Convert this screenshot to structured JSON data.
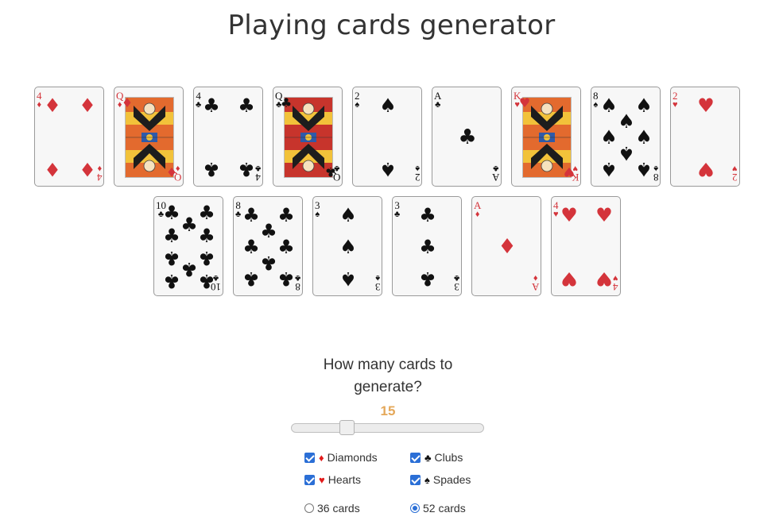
{
  "title": "Playing cards generator",
  "cards": [
    {
      "rank": "4",
      "suit": "diamonds",
      "symbol": "♦",
      "color": "red"
    },
    {
      "rank": "Q",
      "suit": "diamonds",
      "symbol": "♦",
      "color": "red",
      "face": true
    },
    {
      "rank": "4",
      "suit": "clubs",
      "symbol": "♣",
      "color": "black"
    },
    {
      "rank": "Q",
      "suit": "clubs",
      "symbol": "♣",
      "color": "black",
      "face": true
    },
    {
      "rank": "2",
      "suit": "spades",
      "symbol": "♠",
      "color": "black"
    },
    {
      "rank": "A",
      "suit": "clubs",
      "symbol": "♣",
      "color": "black"
    },
    {
      "rank": "K",
      "suit": "hearts",
      "symbol": "♥",
      "color": "red",
      "face": true
    },
    {
      "rank": "8",
      "suit": "spades",
      "symbol": "♠",
      "color": "black"
    },
    {
      "rank": "2",
      "suit": "hearts",
      "symbol": "♥",
      "color": "red"
    },
    {
      "rank": "10",
      "suit": "clubs",
      "symbol": "♣",
      "color": "black"
    },
    {
      "rank": "8",
      "suit": "clubs",
      "symbol": "♣",
      "color": "black"
    },
    {
      "rank": "3",
      "suit": "spades",
      "symbol": "♠",
      "color": "black"
    },
    {
      "rank": "3",
      "suit": "clubs",
      "symbol": "♣",
      "color": "black"
    },
    {
      "rank": "A",
      "suit": "diamonds",
      "symbol": "♦",
      "color": "red"
    },
    {
      "rank": "4",
      "suit": "hearts",
      "symbol": "♥",
      "color": "red"
    }
  ],
  "controls": {
    "question": "How many cards to generate?",
    "count": "15",
    "slider": {
      "min": 1,
      "max": 52,
      "value": 15
    },
    "suits": [
      {
        "label": "Diamonds",
        "symbol": "♦",
        "color": "red",
        "checked": true
      },
      {
        "label": "Clubs",
        "symbol": "♣",
        "color": "black",
        "checked": true
      },
      {
        "label": "Hearts",
        "symbol": "♥",
        "color": "red",
        "checked": true
      },
      {
        "label": "Spades",
        "symbol": "♠",
        "color": "black",
        "checked": true
      }
    ],
    "deck": [
      {
        "label": "36 cards",
        "selected": false
      },
      {
        "label": "52 cards",
        "selected": true
      }
    ]
  },
  "colors": {
    "accent": "#e4a85a",
    "red": "#d4343b",
    "checkbox": "#2b6fd6"
  }
}
